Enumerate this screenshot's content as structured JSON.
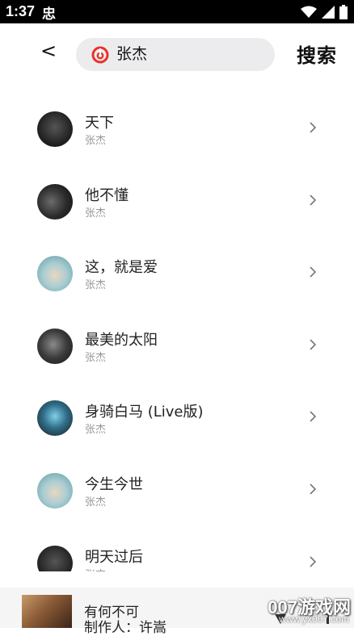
{
  "status_bar": {
    "time": "1:37",
    "app_icon_label": "忠",
    "icons": [
      "wifi-icon",
      "signal-icon",
      "battery-icon"
    ]
  },
  "header": {
    "back_label": "<",
    "search_query": "张杰",
    "search_button_label": "搜索",
    "logo_icon": "netease-music-icon",
    "accent_color": "#e8332a"
  },
  "songs": [
    {
      "title": "天下",
      "artist": "张杰",
      "cover_color": "#1c1c1c"
    },
    {
      "title": "他不懂",
      "artist": "张杰",
      "cover_color": "#2a2a2a"
    },
    {
      "title": "这，就是爱",
      "artist": "张杰",
      "cover_color": "#7fb6c0"
    },
    {
      "title": "最美的太阳",
      "artist": "张杰",
      "cover_color": "#2e2e2e"
    },
    {
      "title": "身骑白马 (Live版)",
      "artist": "张杰",
      "cover_color": "#3a6f86"
    },
    {
      "title": "今生今世",
      "artist": "张杰",
      "cover_color": "#7fb6c0"
    },
    {
      "title": "明天过后",
      "artist": "张杰",
      "cover_color": "#1f1f1f"
    }
  ],
  "mini_player": {
    "title": "有何不可",
    "subtitle": "制作人：许嵩"
  },
  "watermark": {
    "text": "007游戏网",
    "url": "www.yx007.com"
  }
}
